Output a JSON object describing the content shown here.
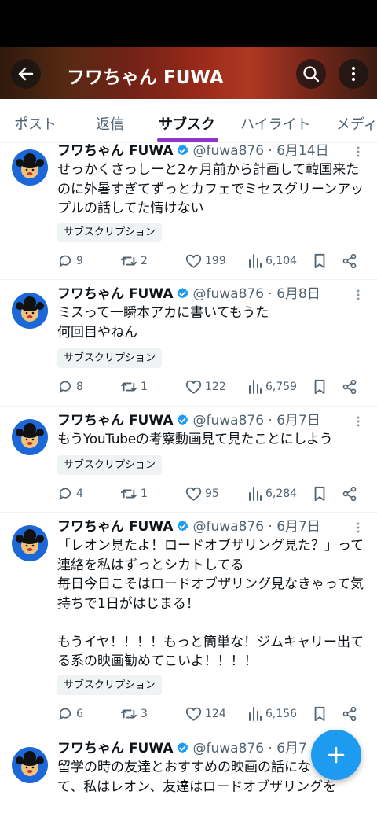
{
  "header": {
    "title": "フワちゃん FUWA"
  },
  "tabs": [
    {
      "label": "ポスト",
      "active": false
    },
    {
      "label": "返信",
      "active": false
    },
    {
      "label": "サブスク",
      "active": true
    },
    {
      "label": "ハイライト",
      "active": false
    },
    {
      "label": "メディ",
      "active": false
    }
  ],
  "colors": {
    "accent": "#1d9bf0",
    "tab_indicator": "#8e35c9",
    "avatar_bg": "#1d68d8",
    "muted": "#536471"
  },
  "tweets": [
    {
      "name": "フワちゃん FUWA",
      "handle": "@fuwa876",
      "date": "6月14日",
      "text": "せっかくさっしーと2ヶ月前から計画して韓国来たのに外暑すぎてずっとカフェでミセスグリーンアップルの話してた情けない",
      "badge": "サブスクリプション",
      "replies": "9",
      "reposts": "2",
      "likes": "199",
      "views": "6,104"
    },
    {
      "name": "フワちゃん FUWA",
      "handle": "@fuwa876",
      "date": "6月8日",
      "text": "ミスって一瞬本アカに書いてもうた\n何回目やねん",
      "badge": "サブスクリプション",
      "replies": "8",
      "reposts": "1",
      "likes": "122",
      "views": "6,759"
    },
    {
      "name": "フワちゃん FUWA",
      "handle": "@fuwa876",
      "date": "6月7日",
      "text": "もうYouTubeの考察動画見て見たことにしよう",
      "badge": "サブスクリプション",
      "replies": "4",
      "reposts": "1",
      "likes": "95",
      "views": "6,284"
    },
    {
      "name": "フワちゃん FUWA",
      "handle": "@fuwa876",
      "date": "6月7日",
      "text": "「レオン見たよ！ロードオブザリング見た？」って連絡を私はずっとシカトしてる\n毎日今日こそはロードオブザリング見なきゃって気持ちで1日がはじまる！\n\nもうイヤ！！！！もっと簡単な！ジムキャリー出てる系の映画勧めてこいよ！！！！",
      "badge": "サブスクリプション",
      "replies": "6",
      "reposts": "3",
      "likes": "124",
      "views": "6,156"
    },
    {
      "name": "フワちゃん FUWA",
      "handle": "@fuwa876",
      "date": "6月7",
      "text": "留学の時の友達とおすすめの映画の話にな\nて、私はレオン、友達はロードオブザリングを"
    }
  ],
  "icons": {
    "back": "arrow-left-icon",
    "search": "search-icon",
    "more": "more-vertical-icon",
    "verified": "verified-badge-icon",
    "reply": "reply-icon",
    "repost": "repost-icon",
    "like": "heart-icon",
    "views": "views-icon",
    "bookmark": "bookmark-icon",
    "share": "share-icon",
    "compose": "plus-icon"
  }
}
